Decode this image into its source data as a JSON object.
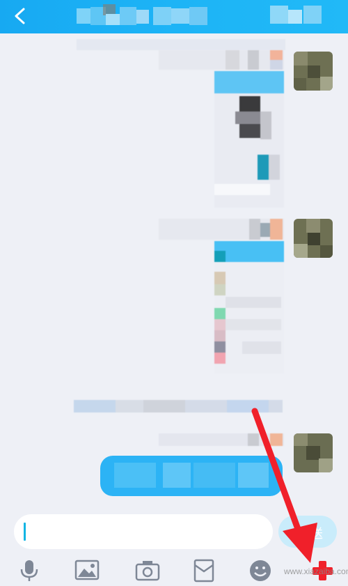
{
  "header": {
    "back_icon": "back-arrow-icon"
  },
  "input": {
    "value": "",
    "placeholder": ""
  },
  "send_button": {
    "label": "发送",
    "visible_label": "送"
  },
  "toolbar": {
    "items": [
      {
        "icon": "microphone-icon"
      },
      {
        "icon": "image-icon"
      },
      {
        "icon": "camera-icon"
      },
      {
        "icon": "red-envelope-icon"
      },
      {
        "icon": "emoji-icon"
      },
      {
        "icon": "plus-icon"
      }
    ]
  },
  "watermark": {
    "text": "www.xiazaiba.com"
  },
  "colors": {
    "header": "#1db4f6",
    "background": "#eef0f6",
    "bubble_blue": "#2cb3f5",
    "arrow_red": "#f0202a",
    "caret": "#10b5e3"
  }
}
